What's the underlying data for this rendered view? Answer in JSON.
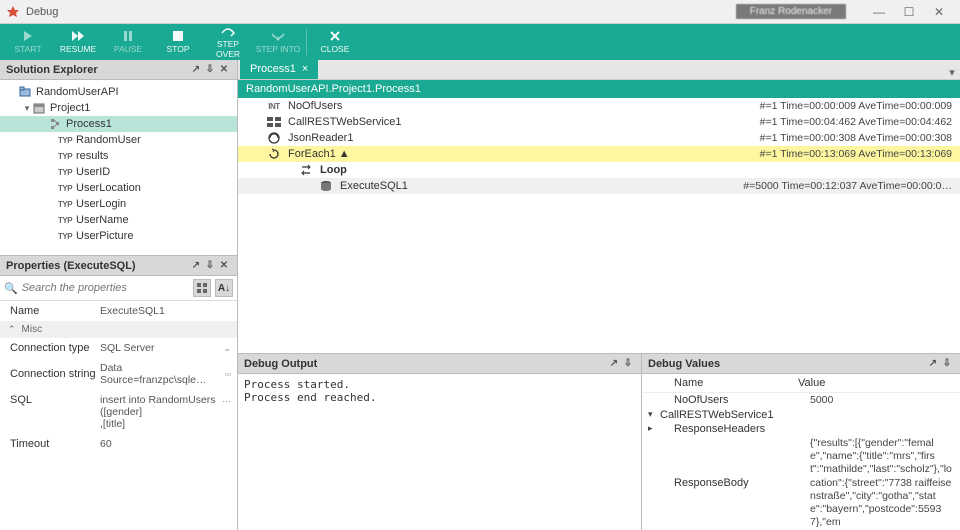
{
  "window": {
    "title": "Debug",
    "user": "Franz Rodenacker"
  },
  "toolbar": {
    "start": "START",
    "resume": "RESUME",
    "pause": "PAUSE",
    "stop": "STOP",
    "step_over": "STEP OVER",
    "step_into": "STEP INTO",
    "close": "CLOSE"
  },
  "explorer": {
    "title": "Solution Explorer",
    "items": [
      {
        "label": "RandomUserAPI",
        "depth": 0,
        "icon": "project"
      },
      {
        "label": "Project1",
        "depth": 1,
        "icon": "project",
        "expanded": true
      },
      {
        "label": "Process1",
        "depth": 2,
        "icon": "process",
        "selected": true
      },
      {
        "label": "RandomUser",
        "depth": 3,
        "icon": "type"
      },
      {
        "label": "results",
        "depth": 3,
        "icon": "type"
      },
      {
        "label": "UserID",
        "depth": 3,
        "icon": "type"
      },
      {
        "label": "UserLocation",
        "depth": 3,
        "icon": "type"
      },
      {
        "label": "UserLogin",
        "depth": 3,
        "icon": "type"
      },
      {
        "label": "UserName",
        "depth": 3,
        "icon": "type"
      },
      {
        "label": "UserPicture",
        "depth": 3,
        "icon": "type"
      }
    ]
  },
  "properties": {
    "title": "Properties (ExecuteSQL)",
    "search_placeholder": "Search the properties",
    "rows": {
      "name_label": "Name",
      "name_value": "ExecuteSQL1",
      "group_misc": "Misc",
      "conn_type_label": "Connection type",
      "conn_type_value": "SQL Server",
      "conn_str_label": "Connection string",
      "conn_str_value": "Data Source=franzpc\\sqle…",
      "sql_label": "SQL",
      "sql_value": "insert into RandomUsers\n([gender]\n,[title]",
      "timeout_label": "Timeout",
      "timeout_value": "60"
    }
  },
  "editor": {
    "tab_label": "Process1",
    "breadcrumb": "RandomUserAPI.Project1.Process1",
    "steps": [
      {
        "name": "NoOfUsers",
        "icon": "int",
        "indent": 1,
        "time": "#=1 Time=00:00:009 AveTime=00:00:009"
      },
      {
        "name": "CallRESTWebService1",
        "icon": "rest",
        "indent": 1,
        "time": "#=1 Time=00:04:462 AveTime=00:04:462"
      },
      {
        "name": "JsonReader1",
        "icon": "json",
        "indent": 1,
        "time": "#=1 Time=00:00:308 AveTime=00:00:308"
      },
      {
        "name": "ForEach1  ▲",
        "icon": "foreach",
        "indent": 1,
        "time": "#=1 Time=00:13:069 AveTime=00:13:069",
        "hl": true
      },
      {
        "name": "Loop",
        "icon": "loop",
        "indent": 2,
        "time": ""
      },
      {
        "name": "ExecuteSQL1",
        "icon": "db",
        "indent": 3,
        "time": "#=5000 Time=00:12:037 AveTime=00:00:0…",
        "dim": true
      }
    ]
  },
  "output": {
    "title": "Debug Output",
    "text": "Process started.\nProcess end reached."
  },
  "values": {
    "title": "Debug Values",
    "col_name": "Name",
    "col_value": "Value",
    "rows": {
      "noofusers_name": "NoOfUsers",
      "noofusers_value": "5000",
      "callrest_name": "CallRESTWebService1",
      "respheaders_name": "ResponseHeaders",
      "respbody_name": "ResponseBody",
      "respbody_value": "{\"results\":[{\"gender\":\"female\",\"name\":{\"title\":\"mrs\",\"first\":\"mathilde\",\"last\":\"scholz\"},\"location\":{\"street\":\"7738 raiffeisenstraße\",\"city\":\"gotha\",\"state\":\"bayern\",\"postcode\":55937},\"em"
    }
  }
}
